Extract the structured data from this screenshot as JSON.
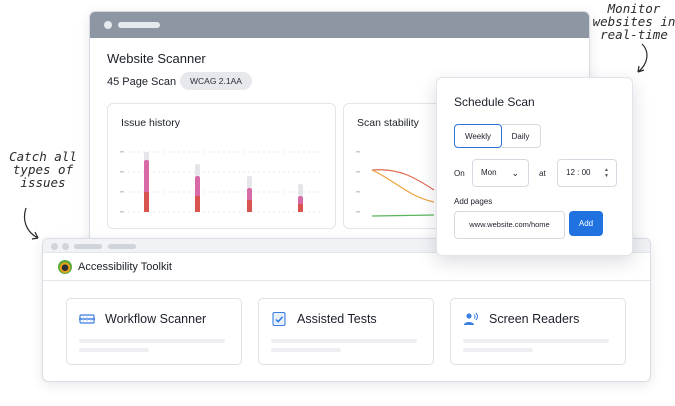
{
  "annotations": {
    "top_right": "Monitor websites in real-time",
    "left": "Catch all types of issues"
  },
  "scanner": {
    "title": "Website Scanner",
    "scan_label": "45 Page Scan",
    "badge": "WCAG 2.1AA",
    "cards": {
      "history_title": "Issue history",
      "stability_title": "Scan stability"
    }
  },
  "schedule": {
    "title": "Schedule Scan",
    "freq_weekly": "Weekly",
    "freq_daily": "Daily",
    "on_label": "On",
    "day_value": "Mon",
    "at_label": "at",
    "time_value": "12 : 00",
    "add_pages_label": "Add pages",
    "url_value": "www.website.com/home",
    "add_button": "Add"
  },
  "toolkit": {
    "title": "Accessibility Toolkit",
    "tools": [
      {
        "label": "Workflow Scanner",
        "icon": "scanner-icon"
      },
      {
        "label": "Assisted Tests",
        "icon": "checklist-icon"
      },
      {
        "label": "Screen Readers",
        "icon": "speaker-person-icon"
      }
    ]
  },
  "colors": {
    "accent": "#1f72e0",
    "bar_pink": "#d96aa8",
    "bar_red": "#d9534f",
    "bar_grey": "#e3e5e9",
    "line_red": "#e0654c",
    "line_orange": "#eea23a",
    "line_green": "#58b55a"
  }
}
